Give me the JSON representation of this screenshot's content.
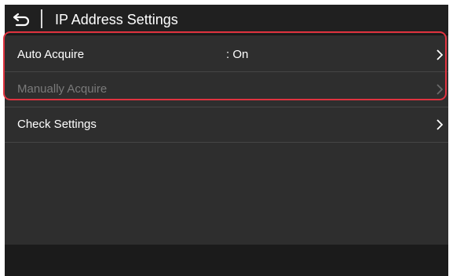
{
  "header": {
    "title": "IP Address Settings",
    "back_icon": "back-arrow-icon"
  },
  "menu": {
    "items": [
      {
        "label": "Auto Acquire",
        "value": ": On",
        "enabled": true
      },
      {
        "label": "Manually Acquire",
        "value": "",
        "enabled": false
      },
      {
        "label": "Check Settings",
        "value": "",
        "enabled": true
      }
    ]
  },
  "colors": {
    "background": "#2e2e2e",
    "header": "#202020",
    "text": "#ffffff",
    "disabled_text": "#7a7a7a",
    "highlight": "#e0333f"
  }
}
